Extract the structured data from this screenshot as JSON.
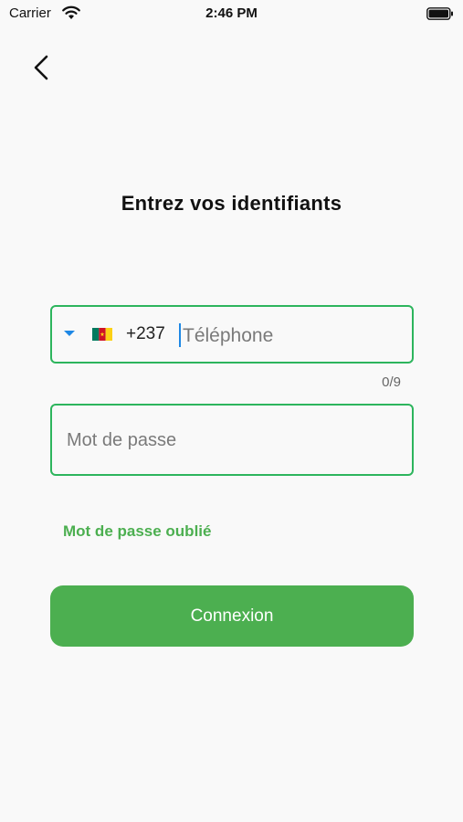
{
  "status_bar": {
    "carrier": "Carrier",
    "time": "2:46 PM"
  },
  "page": {
    "title": "Entrez vos identifiants"
  },
  "phone_field": {
    "dial_code": "+237",
    "placeholder": "Téléphone",
    "value": "",
    "counter": "0/9",
    "flag": "cameroon-flag"
  },
  "password_field": {
    "placeholder": "Mot de passe",
    "value": ""
  },
  "forgot_password": {
    "label": "Mot de passe oublié"
  },
  "login_button": {
    "label": "Connexion"
  },
  "colors": {
    "accent": "#4caf50",
    "field_border": "#2db55d",
    "cursor": "#1e88e5",
    "background": "#f9f9f9"
  }
}
